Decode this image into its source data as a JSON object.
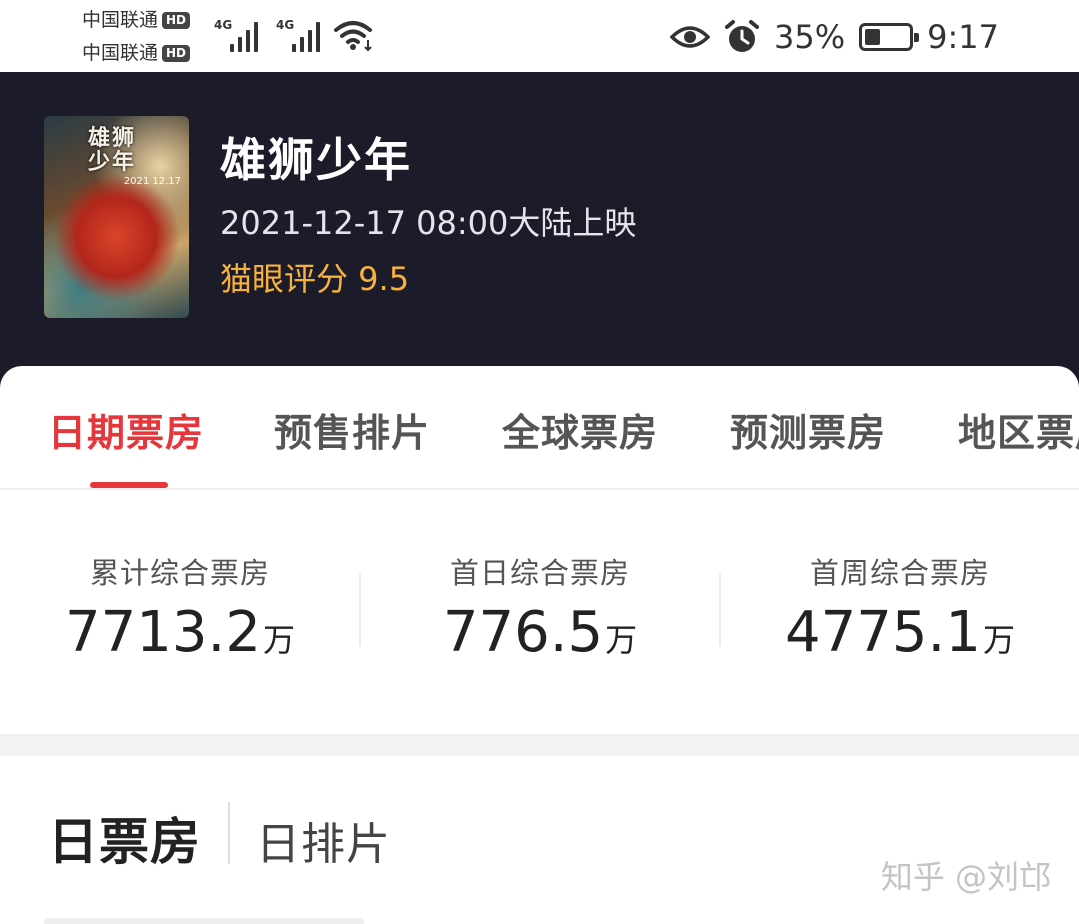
{
  "status_bar": {
    "carrier1": "中国联通",
    "carrier2": "中国联通",
    "hd_badge": "HD",
    "network1": "4G",
    "network2": "4G",
    "battery_percent": "35%",
    "battery_level": 0.35,
    "time": "9:17"
  },
  "movie": {
    "title": "雄狮少年",
    "release": "2021-12-17 08:00大陆上映",
    "rating": "猫眼评分 9.5",
    "poster_title": "雄狮少年",
    "poster_date": "2021 12.17"
  },
  "tabs": [
    {
      "label": "日期票房",
      "active": true
    },
    {
      "label": "预售排片",
      "active": false
    },
    {
      "label": "全球票房",
      "active": false
    },
    {
      "label": "预测票房",
      "active": false
    },
    {
      "label": "地区票房",
      "active": false
    }
  ],
  "stats": [
    {
      "label": "累计综合票房",
      "value": "7713.2",
      "unit": "万"
    },
    {
      "label": "首日综合票房",
      "value": "776.5",
      "unit": "万"
    },
    {
      "label": "首周综合票房",
      "value": "4775.1",
      "unit": "万"
    }
  ],
  "subtabs": {
    "active": "日票房",
    "inactive": "日排片"
  },
  "watermark": "知乎 @刘邙",
  "colors": {
    "accent_red": "#e5363c",
    "header_bg": "#1c1b29",
    "rating_gold": "#f7b23e"
  }
}
